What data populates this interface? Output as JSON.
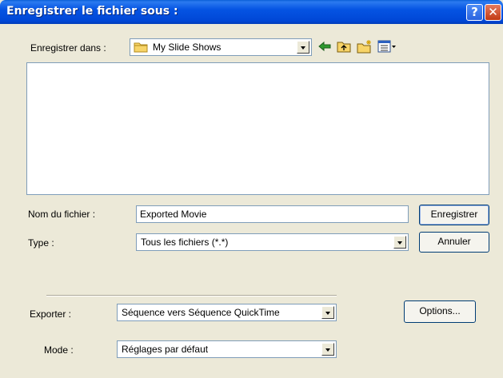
{
  "title": "Enregistrer le fichier sous :",
  "titlebar_buttons": {
    "help": "?",
    "close": "✕"
  },
  "save_in": {
    "label": "Enregistrer dans :",
    "value": "My Slide Shows"
  },
  "toolbar": [
    "back-icon",
    "up-folder-icon",
    "new-folder-icon",
    "view-menu-icon"
  ],
  "file_name": {
    "label": "Nom du fichier :",
    "value": "Exported Movie"
  },
  "file_type": {
    "label": "Type :",
    "value": "Tous les fichiers (*.*)"
  },
  "buttons": {
    "save": "Enregistrer",
    "cancel": "Annuler",
    "options": "Options..."
  },
  "export": {
    "label": "Exporter :",
    "value": "Séquence vers Séquence QuickTime"
  },
  "mode": {
    "label": "Mode :",
    "value": "Réglages par défaut"
  },
  "colors": {
    "title_bar": "#0054e3",
    "face": "#ece9d8",
    "field_border": "#7f9db9"
  }
}
